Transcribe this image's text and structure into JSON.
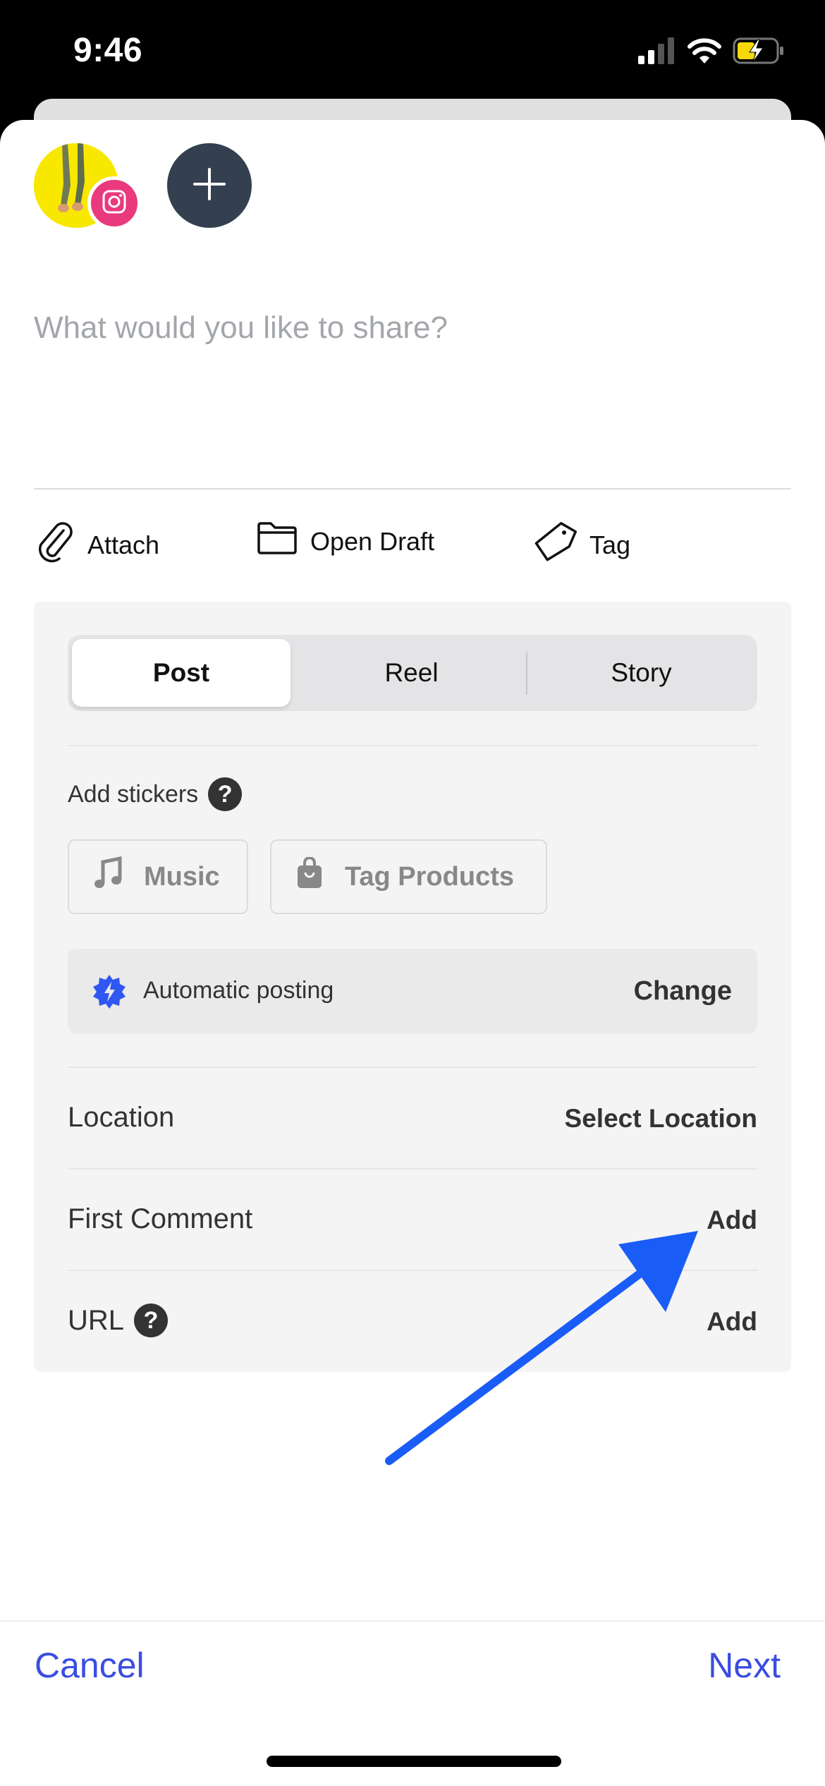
{
  "status_bar": {
    "time": "9:46",
    "icons": [
      "cellular-signal-icon",
      "wifi-icon",
      "battery-charging-icon"
    ],
    "battery_color": "#f5d90a"
  },
  "accounts": {
    "selected_account": {
      "network": "instagram",
      "badge_icon": "instagram-icon",
      "badge_color": "#e93a7d"
    },
    "add_account_icon": "plus-icon"
  },
  "composer": {
    "placeholder": "What would you like to share?",
    "value": ""
  },
  "actions": [
    {
      "label": "Attach",
      "icon": "paperclip-icon"
    },
    {
      "label": "Open Draft",
      "icon": "folder-icon"
    },
    {
      "label": "Tag",
      "icon": "tag-icon"
    }
  ],
  "post_type": {
    "options": [
      "Post",
      "Reel",
      "Story"
    ],
    "selected": "Post"
  },
  "stickers": {
    "label": "Add stickers",
    "help_icon": "question-mark-icon",
    "buttons": [
      {
        "label": "Music",
        "icon": "music-note-icon"
      },
      {
        "label": "Tag Products",
        "icon": "shopping-bag-icon"
      }
    ]
  },
  "publishing": {
    "icon": "gear-lightning-icon",
    "label": "Automatic posting",
    "action": "Change",
    "accent": "#3057f2"
  },
  "rows": [
    {
      "label": "Location",
      "action": "Select Location",
      "help": false
    },
    {
      "label": "First Comment",
      "action": "Add",
      "help": false
    },
    {
      "label": "URL",
      "action": "Add",
      "help": true
    }
  ],
  "footer": {
    "cancel": "Cancel",
    "next": "Next",
    "link_color": "#3a4de0"
  },
  "annotation": {
    "type": "arrow",
    "color": "#1a5cf6",
    "points_to": "First Comment Add"
  }
}
